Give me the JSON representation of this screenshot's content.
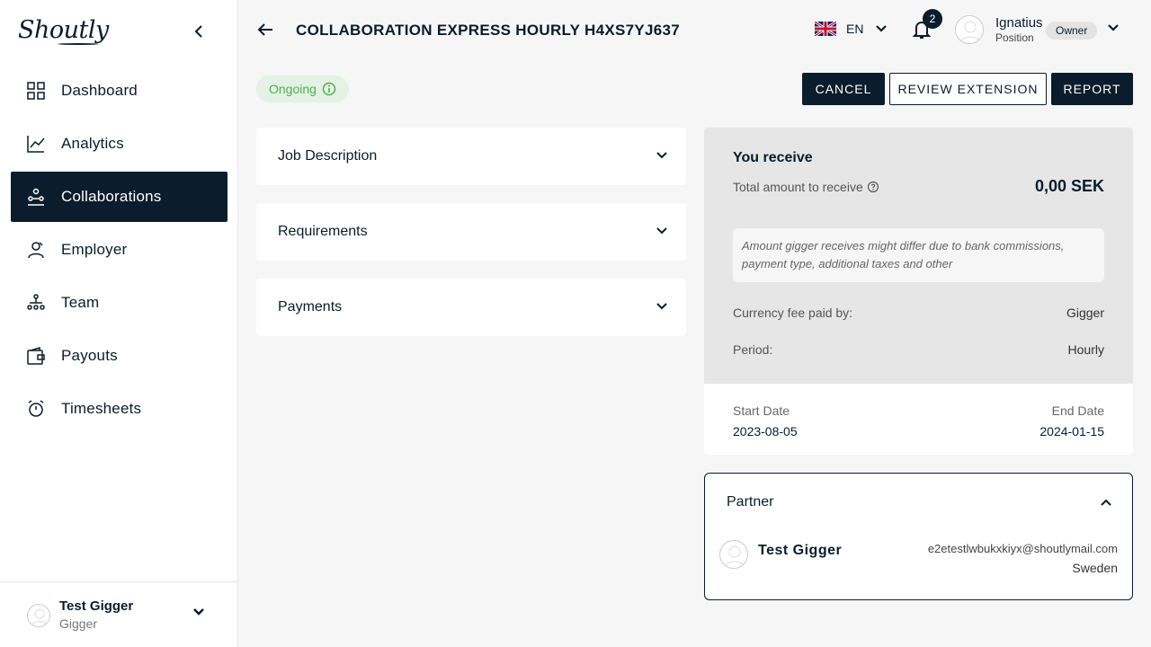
{
  "app": {
    "logo": "Shoutly"
  },
  "sidebar": {
    "items": [
      {
        "label": "Dashboard",
        "icon": "dashboard-grid-icon"
      },
      {
        "label": "Analytics",
        "icon": "chart-line-icon"
      },
      {
        "label": "Collaborations",
        "icon": "collaborations-icon",
        "active": true
      },
      {
        "label": "Employer",
        "icon": "employer-icon"
      },
      {
        "label": "Team",
        "icon": "team-icon"
      },
      {
        "label": "Payouts",
        "icon": "wallet-icon"
      },
      {
        "label": "Timesheets",
        "icon": "stopwatch-icon"
      }
    ],
    "footer": {
      "name": "Test Gigger",
      "role": "Gigger"
    }
  },
  "header": {
    "title": "COLLABORATION EXPRESS HOURLY H4XS7YJ637",
    "language": "EN",
    "notifications_count": "2",
    "user_name": "Ignatius",
    "user_position": "Position",
    "user_role": "Owner"
  },
  "status": {
    "label": "Ongoing",
    "color": "#4caf50"
  },
  "actions": {
    "cancel": "CANCEL",
    "review_extension": "REVIEW EXTENSION",
    "report": "REPORT"
  },
  "sections": {
    "job_description": "Job Description",
    "requirements": "Requirements",
    "payments": "Payments"
  },
  "receive": {
    "title": "You receive",
    "total_label": "Total amount to receive",
    "total_value": "0,00 SEK",
    "note": "Amount gigger receives might differ due to bank commissions, payment type, additional taxes and other",
    "fee_label": "Currency fee paid by:",
    "fee_value": "Gigger",
    "period_label": "Period:",
    "period_value": "Hourly"
  },
  "dates": {
    "start_label": "Start Date",
    "start_value": "2023-08-05",
    "end_label": "End Date",
    "end_value": "2024-01-15"
  },
  "partner": {
    "title": "Partner",
    "name": "Test Gigger",
    "email": "e2etestlwbukxkiyx@shoutlymail.com",
    "country": "Sweden"
  },
  "colors": {
    "brand_dark": "#0b1c2c",
    "background": "#f6f6f6",
    "status_green": "#4caf50"
  }
}
